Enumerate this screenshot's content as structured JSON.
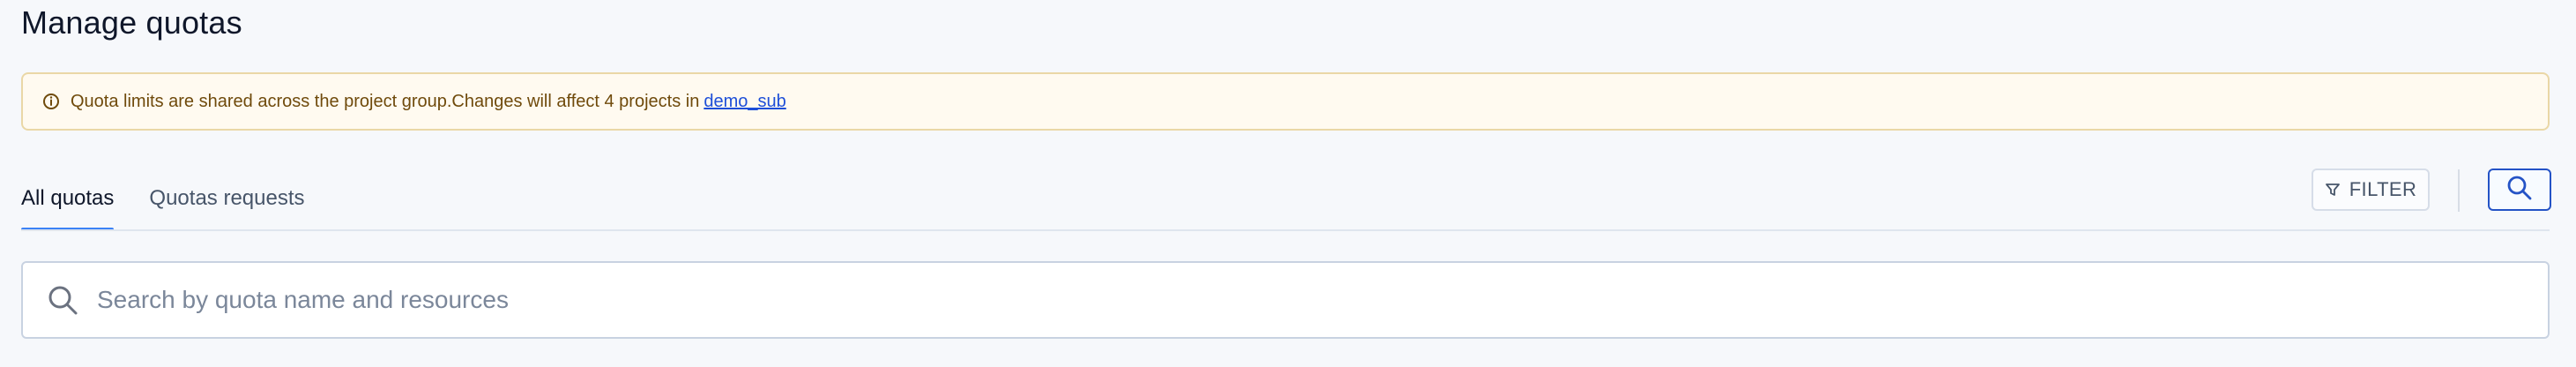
{
  "page": {
    "title": "Manage quotas"
  },
  "alert": {
    "message": "Quota limits are shared across the project group.Changes will affect 4 projects in",
    "link_text": "demo_sub",
    "icon": "info-circle-icon"
  },
  "tabs": [
    {
      "label": "All quotas",
      "active": true
    },
    {
      "label": "Quotas requests",
      "active": false
    }
  ],
  "toolbar": {
    "filter_label": "FILTER",
    "filter_icon": "filter-icon",
    "search_icon": "search-icon"
  },
  "search": {
    "placeholder": "Search by quota name and resources",
    "value": "",
    "icon": "search-icon"
  },
  "colors": {
    "background": "#f6f8fb",
    "alert_background": "#fffaf0",
    "alert_border": "#ead7a6",
    "alert_text": "#6f4a0b",
    "link": "#1d4ed8",
    "accent": "#3b82f6",
    "search_toggle_border": "#2453c6"
  }
}
